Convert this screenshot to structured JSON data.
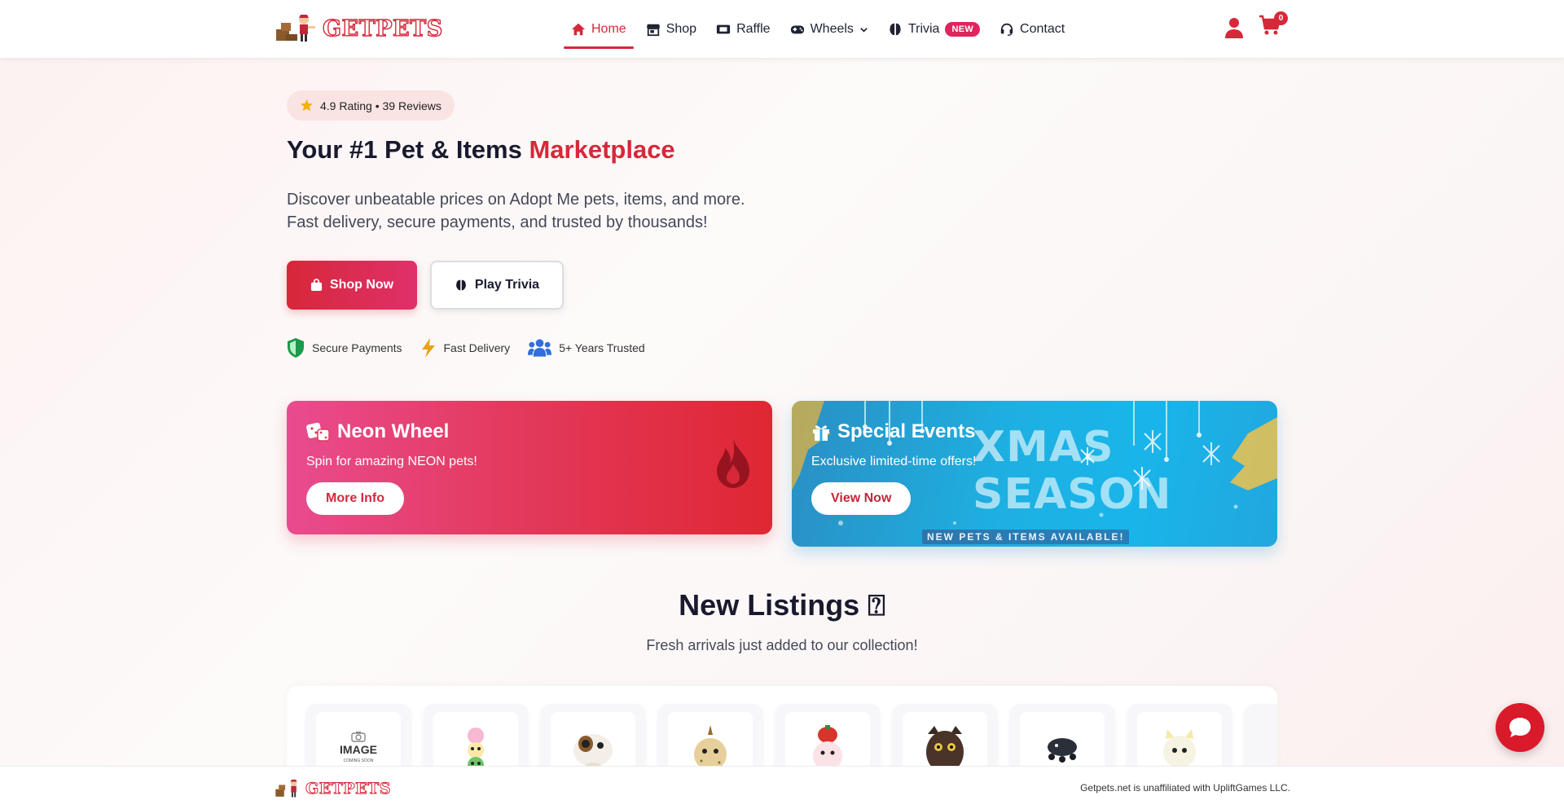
{
  "brand": {
    "name": "GETPETS"
  },
  "nav": {
    "items": [
      {
        "label": "Home",
        "icon": "home-icon",
        "active": true
      },
      {
        "label": "Shop",
        "icon": "store-icon"
      },
      {
        "label": "Raffle",
        "icon": "ticket-icon"
      },
      {
        "label": "Wheels",
        "icon": "gamepad-icon",
        "dropdown": true
      },
      {
        "label": "Trivia",
        "icon": "brain-icon",
        "badge": "NEW"
      },
      {
        "label": "Contact",
        "icon": "headset-icon"
      }
    ],
    "cart_count": "0"
  },
  "hero": {
    "rating": "4.9 Rating • 39 Reviews",
    "title_main": "Your #1 Pet & Items ",
    "title_accent": "Marketplace",
    "subtitle_line1": "Discover unbeatable prices on Adopt Me pets, items, and more.",
    "subtitle_line2": "Fast delivery, secure payments, and trusted by thousands!",
    "shop_label": "Shop Now",
    "trivia_label": "Play Trivia",
    "trust": [
      {
        "label": "Secure Payments",
        "icon": "shield-icon"
      },
      {
        "label": "Fast Delivery",
        "icon": "lightning-icon"
      },
      {
        "label": "5+ Years Trusted",
        "icon": "users-icon"
      }
    ]
  },
  "promos": {
    "neon": {
      "title": "Neon Wheel",
      "subtitle": "Spin for amazing NEON pets!",
      "button": "More Info"
    },
    "events": {
      "title": "Special Events",
      "subtitle": "Exclusive limited-time offers!",
      "button": "View Now",
      "banner_big": "XMAS SEASON",
      "banner_small": "NEW PETS & ITEMS AVAILABLE!"
    }
  },
  "listings": {
    "title": "New Listings",
    "title_emoji": "⍰",
    "subtitle": "Fresh arrivals just added to our collection!",
    "placeholder_main": "IMAGE",
    "placeholder_small": "COMING SOON"
  },
  "footer": {
    "note": "Getpets.net is unaffiliated with UpliftGames LLC."
  },
  "colors": {
    "accent": "#d62839",
    "accent_pink": "#e0306a",
    "events_blue": "#1eb0e2"
  }
}
